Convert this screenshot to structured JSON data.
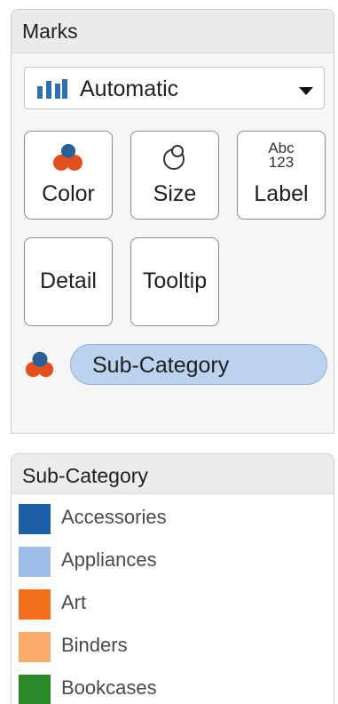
{
  "marks_card": {
    "title": "Marks",
    "mark_type": {
      "label": "Automatic",
      "icon": "bar-chart-icon",
      "dropdown_icon": "caret-down-icon"
    },
    "tiles": [
      {
        "label": "Color",
        "icon": "color-circles-icon"
      },
      {
        "label": "Size",
        "icon": "size-circles-icon"
      },
      {
        "label": "Label",
        "icon": "abc-123-icon",
        "icon_text_top": "Abc",
        "icon_text_bottom": "123"
      },
      {
        "label": "Detail"
      },
      {
        "label": "Tooltip"
      }
    ],
    "field": {
      "encoding_icon": "color-circles-icon",
      "name": "Sub-Category"
    }
  },
  "legend": {
    "title": "Sub-Category",
    "items": [
      {
        "label": "Accessories",
        "color": "#1f5fa8"
      },
      {
        "label": "Appliances",
        "color": "#9fbde6"
      },
      {
        "label": "Art",
        "color": "#f2701d"
      },
      {
        "label": "Binders",
        "color": "#f9ac6c"
      },
      {
        "label": "Bookcases",
        "color": "#2a8a2a"
      }
    ]
  },
  "colors": {
    "pill_fill": "#bcd3ef",
    "bar_icon": "#2f6fb0",
    "icon_blue": "#2b5f99",
    "icon_orange": "#e2511d"
  }
}
